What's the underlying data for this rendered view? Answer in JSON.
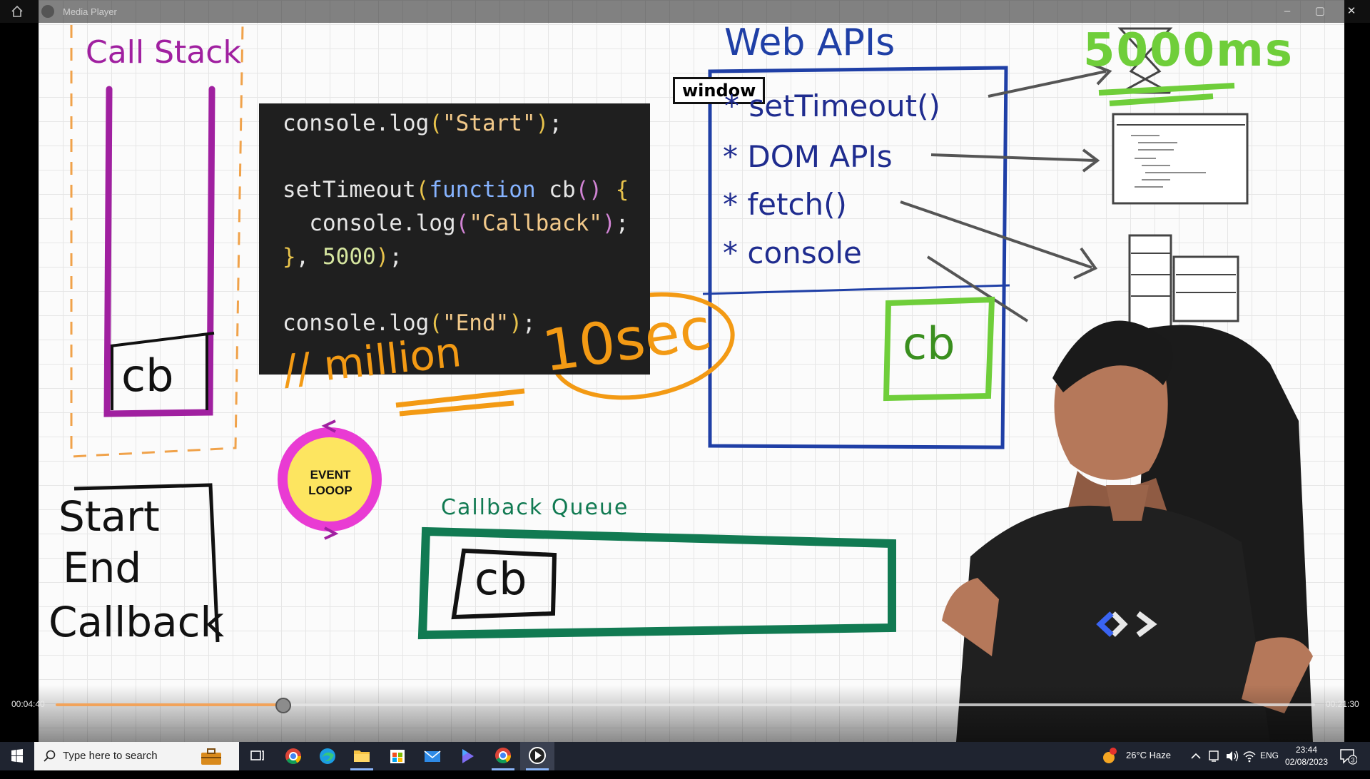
{
  "window": {
    "title": "Media Player",
    "minimize": "–",
    "maximize": "▢",
    "close": "✕"
  },
  "video": {
    "callstack_title": "Call Stack",
    "callstack_cb": "cb",
    "code_lines": [
      {
        "parts": [
          [
            "fn",
            "console.log"
          ],
          [
            "br",
            "("
          ],
          [
            "str",
            "\"Start\""
          ],
          [
            "br",
            ")"
          ],
          [
            "fn",
            ";"
          ]
        ]
      },
      {
        "parts": [
          [
            "fn",
            "setTimeout"
          ],
          [
            "br",
            "("
          ],
          [
            "kw",
            "function "
          ],
          [
            "fn",
            "cb"
          ],
          [
            "pk",
            "() "
          ],
          [
            "br",
            "{"
          ]
        ]
      },
      {
        "parts": [
          [
            "fn",
            "  console.log"
          ],
          [
            "pk",
            "("
          ],
          [
            "str",
            "\"Callback\""
          ],
          [
            "pk",
            ")"
          ],
          [
            "fn",
            ";"
          ]
        ]
      },
      {
        "parts": [
          [
            "br",
            "}"
          ],
          [
            "fn",
            ", "
          ],
          [
            "num",
            "5000"
          ],
          [
            "br",
            ")"
          ],
          [
            "fn",
            ";"
          ]
        ]
      },
      {
        "parts": [
          [
            "fn",
            "console.log"
          ],
          [
            "br",
            "("
          ],
          [
            "str",
            "\"End\""
          ],
          [
            "br",
            ")"
          ],
          [
            "fn",
            ";"
          ]
        ]
      }
    ],
    "webapis_title": "Web APIs",
    "window_label": "window",
    "api_items": [
      "* setTimeout()",
      "* DOM APIs",
      "* fetch()",
      "* console"
    ],
    "webapis_cb": "cb",
    "timer_label": "5000ms",
    "annotation_million": "// million",
    "annotation_tosec": "10sec",
    "event_loop_line1": "EVENT",
    "event_loop_line2": "LOOOP",
    "callback_queue_title": "Callback Queue",
    "callback_queue_cb": "cb",
    "output_lines": [
      "Start",
      "End",
      "Callback"
    ]
  },
  "player": {
    "elapsed": "00:04:40",
    "duration": "00:21:30",
    "progress": 0.18
  },
  "taskbar": {
    "search_placeholder": "Type here to search",
    "weather": "26°C  Haze",
    "language": "ENG",
    "time": "23:44",
    "date": "02/08/2023",
    "notifications": "3"
  },
  "colors": {
    "callstack": "#a020a0",
    "webapis": "#1f3fa6",
    "timer": "#6fce3a",
    "annotation": "#f39a14",
    "queue": "#117a52",
    "progress_fill": "#f2a35a"
  }
}
